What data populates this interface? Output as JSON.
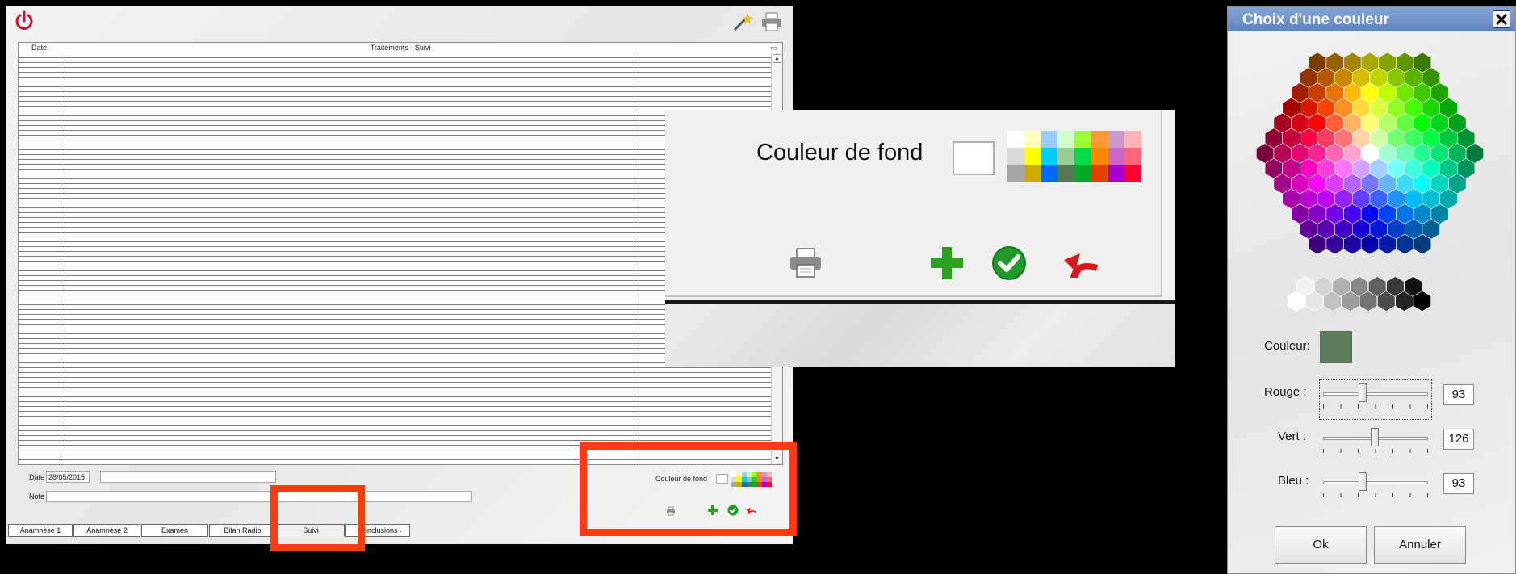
{
  "main": {
    "grid": {
      "col_date": "Date",
      "title": "Traitements - Suivi"
    },
    "form": {
      "date_label": "Date",
      "date_value": "28/05/2015",
      "note_label": "Note",
      "couleur_label": "Couleur de fond"
    },
    "tabs": [
      "Anamnèse 1",
      "Anamnèse 2",
      "Examen",
      "Bilan Radio",
      "Suivi",
      "Conclusions",
      "."
    ],
    "active_tab": "Suivi"
  },
  "zoom": {
    "label": "Couleur de fond"
  },
  "palette": [
    "#ffffff",
    "#ffffc0",
    "#99ccff",
    "#ccffcc",
    "#99ff33",
    "#ff9933",
    "#cc99cc",
    "#ffb3b3",
    "#d9d9d9",
    "#ffff00",
    "#00ccff",
    "#99cc99",
    "#00dd44",
    "#ff8800",
    "#cc66cc",
    "#ff6677",
    "#a6a6a6",
    "#ccaa00",
    "#0066ff",
    "#557755",
    "#00aa22",
    "#dd4400",
    "#aa00cc",
    "#ff0033"
  ],
  "dialog": {
    "title": "Choix d'une couleur",
    "couleur_label": "Couleur:",
    "chosen_color": "#5d7e5d",
    "rouge_label": "Rouge :",
    "vert_label": "Vert :",
    "bleu_label": "Bleu :",
    "rouge": "93",
    "vert": "126",
    "bleu": "93",
    "ok_label": "Ok",
    "cancel_label": "Annuler"
  },
  "colors": {
    "highlight": "#ff3b12",
    "power": "#c8102e",
    "plus": "#2e9e1e",
    "check": "#1f9a2a",
    "undo": "#d8171f",
    "title_bar": "#6b8fc8"
  }
}
